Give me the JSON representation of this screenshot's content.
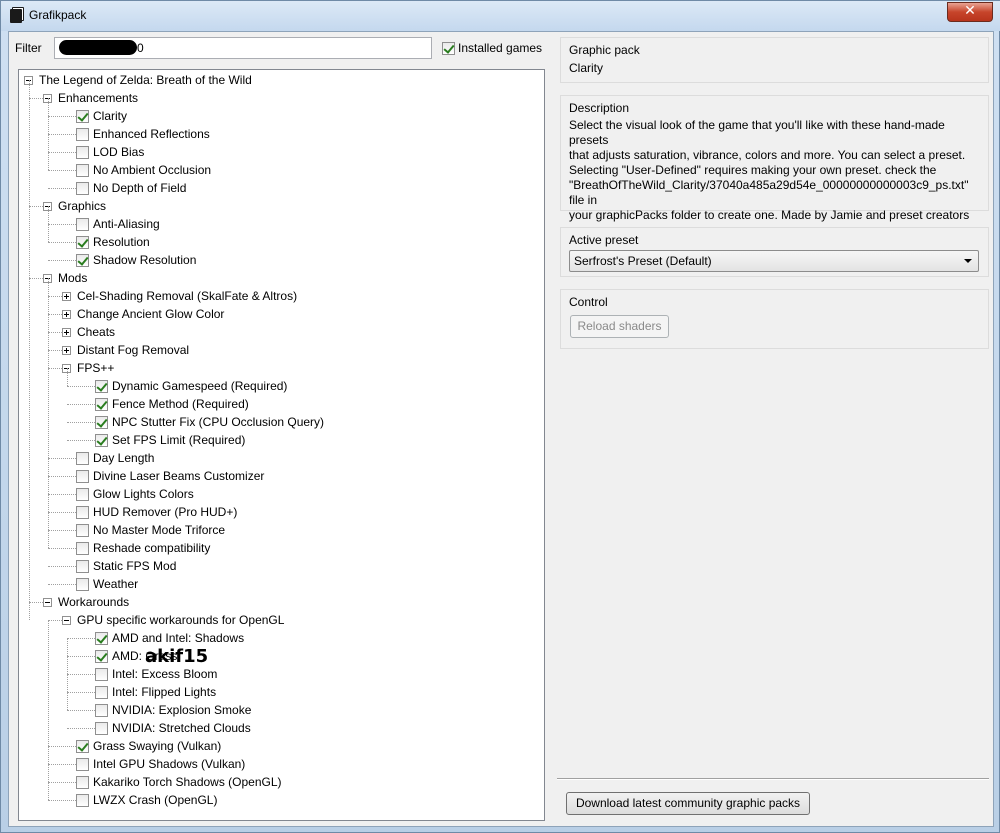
{
  "window": {
    "title": "Grafikpack",
    "close_glyph": "✕"
  },
  "filter": {
    "label": "Filter",
    "value": "0"
  },
  "installed_games": {
    "label": "Installed games",
    "checked": true
  },
  "tree": {
    "root": "The Legend of Zelda: Breath of the Wild",
    "enhancements": {
      "label": "Enhancements",
      "items": [
        {
          "label": "Clarity",
          "checked": true
        },
        {
          "label": "Enhanced Reflections",
          "checked": false
        },
        {
          "label": "LOD Bias",
          "checked": false
        },
        {
          "label": "No Ambient Occlusion",
          "checked": false
        },
        {
          "label": "No Depth of Field",
          "checked": false
        }
      ]
    },
    "graphics": {
      "label": "Graphics",
      "items": [
        {
          "label": "Anti-Aliasing",
          "checked": false
        },
        {
          "label": "Resolution",
          "checked": true
        },
        {
          "label": "Shadow Resolution",
          "checked": true
        }
      ]
    },
    "mods": {
      "label": "Mods",
      "folders": [
        "Cel-Shading Removal (SkalFate & Altros)",
        "Change Ancient Glow Color",
        "Cheats",
        "Distant Fog Removal"
      ],
      "fps_label": "FPS++",
      "fps_items": [
        {
          "label": "Dynamic Gamespeed (Required)",
          "checked": true
        },
        {
          "label": "Fence Method (Required)",
          "checked": true
        },
        {
          "label": "NPC Stutter Fix (CPU Occlusion Query)",
          "checked": true
        },
        {
          "label": "Set FPS Limit (Required)",
          "checked": true
        }
      ],
      "items": [
        {
          "label": "Day Length",
          "checked": false
        },
        {
          "label": "Divine Laser Beams Customizer",
          "checked": false
        },
        {
          "label": "Glow Lights Colors",
          "checked": false
        },
        {
          "label": "HUD Remover (Pro HUD+)",
          "checked": false
        },
        {
          "label": "No Master Mode Triforce",
          "checked": false
        },
        {
          "label": "Reshade compatibility",
          "checked": false
        },
        {
          "label": "Static FPS Mod",
          "checked": false
        },
        {
          "label": "Weather",
          "checked": false
        }
      ]
    },
    "workarounds": {
      "label": "Workarounds",
      "gpu_label": "GPU specific workarounds for OpenGL",
      "gpu_items": [
        {
          "label": "AMD and Intel: Shadows",
          "checked": true
        },
        {
          "label": "AMD: Grass",
          "checked": true
        },
        {
          "label": "Intel: Excess Bloom",
          "checked": false
        },
        {
          "label": "Intel: Flipped Lights",
          "checked": false
        },
        {
          "label": "NVIDIA: Explosion Smoke",
          "checked": false
        },
        {
          "label": "NVIDIA: Stretched Clouds",
          "checked": false
        }
      ],
      "items": [
        {
          "label": "Grass Swaying (Vulkan)",
          "checked": true
        },
        {
          "label": "Intel GPU Shadows (Vulkan)",
          "checked": false
        },
        {
          "label": "Kakariko Torch Shadows (OpenGL)",
          "checked": false
        },
        {
          "label": "LWZX Crash (OpenGL)",
          "checked": false
        }
      ]
    }
  },
  "graphic_pack": {
    "title": "Graphic pack",
    "name": "Clarity"
  },
  "description": {
    "title": "Description",
    "lines": [
      "Select the visual look of the game that you'll like with these hand-made",
      "presets",
      "that adjusts saturation, vibrance, colors and more. You can select a preset.",
      "Selecting \"User-Defined\" requires making your own preset. check the",
      "\"BreathOfTheWild_Clarity/37040a485a29d54e_00000000000003c9_ps.txt\" file in",
      "your graphicPacks folder to create one. Made by Jamie and preset creators"
    ]
  },
  "active_preset": {
    "title": "Active preset",
    "value": "Serfrost's Preset (Default)"
  },
  "control": {
    "title": "Control",
    "reload_label": "Reload shaders"
  },
  "download_label": "Download latest community graphic packs",
  "watermark": "akif15"
}
